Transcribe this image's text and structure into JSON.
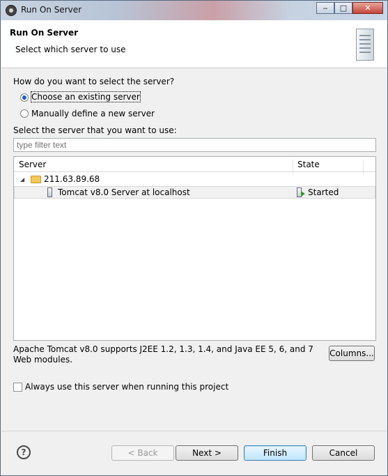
{
  "window": {
    "title": "Run On Server",
    "minimize_glyph": "‒",
    "maximize_glyph": "□",
    "close_glyph": "✕"
  },
  "header": {
    "title": "Run On Server",
    "subtitle": "Select which server to use",
    "icon": "server-icon"
  },
  "question": "How do you want to select the server?",
  "radios": [
    {
      "label": "Choose an existing server",
      "selected": true
    },
    {
      "label": "Manually define a new server",
      "selected": false
    }
  ],
  "select_label": "Select the server that you want to use:",
  "filter": {
    "value": "",
    "placeholder": "type filter text"
  },
  "table": {
    "columns": [
      "Server",
      "State"
    ],
    "rows": [
      {
        "name": "211.63.89.68",
        "state": "",
        "level": 0,
        "expanded": true,
        "icon": "folder-open-icon"
      },
      {
        "name": "Tomcat v8.0 Server at localhost",
        "state": "Started",
        "level": 1,
        "icon": "server-icon",
        "state_icon": "server-started-icon"
      }
    ]
  },
  "description": "Apache Tomcat v8.0 supports J2EE 1.2, 1.3, 1.4, and Java EE 5, 6, and 7 Web modules.",
  "columns_button": "Columns...",
  "always_use": {
    "label": "Always use this server when running this project",
    "checked": false
  },
  "buttons": {
    "help": "?",
    "back": "< Back",
    "next": "Next >",
    "finish": "Finish",
    "cancel": "Cancel"
  }
}
